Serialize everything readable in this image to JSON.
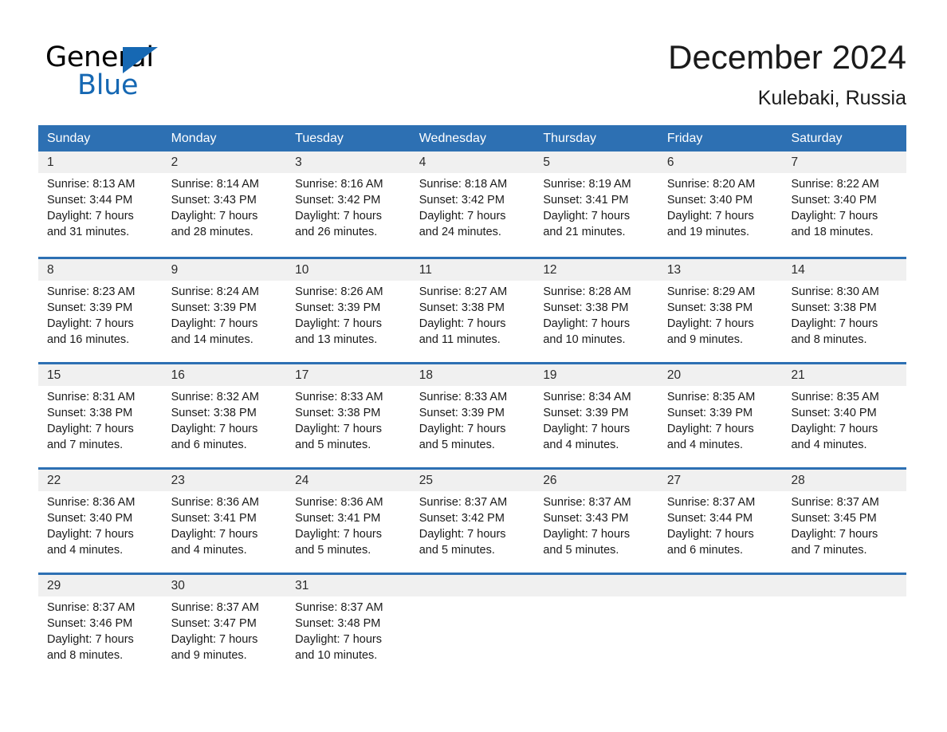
{
  "brand": {
    "name_top": "General",
    "name_bottom": "Blue",
    "color_blue": "#1668b3"
  },
  "header": {
    "month_title": "December 2024",
    "location": "Kulebaki, Russia"
  },
  "theme": {
    "header_blue": "#2d70b3",
    "band_gray": "#f0f0f0",
    "text": "#1a1a1a"
  },
  "calendar": {
    "weekday_headers": [
      "Sunday",
      "Monday",
      "Tuesday",
      "Wednesday",
      "Thursday",
      "Friday",
      "Saturday"
    ],
    "weeks": [
      [
        {
          "day": "1",
          "sunrise": "Sunrise: 8:13 AM",
          "sunset": "Sunset: 3:44 PM",
          "daylight_line1": "Daylight: 7 hours",
          "daylight_line2": "and 31 minutes."
        },
        {
          "day": "2",
          "sunrise": "Sunrise: 8:14 AM",
          "sunset": "Sunset: 3:43 PM",
          "daylight_line1": "Daylight: 7 hours",
          "daylight_line2": "and 28 minutes."
        },
        {
          "day": "3",
          "sunrise": "Sunrise: 8:16 AM",
          "sunset": "Sunset: 3:42 PM",
          "daylight_line1": "Daylight: 7 hours",
          "daylight_line2": "and 26 minutes."
        },
        {
          "day": "4",
          "sunrise": "Sunrise: 8:18 AM",
          "sunset": "Sunset: 3:42 PM",
          "daylight_line1": "Daylight: 7 hours",
          "daylight_line2": "and 24 minutes."
        },
        {
          "day": "5",
          "sunrise": "Sunrise: 8:19 AM",
          "sunset": "Sunset: 3:41 PM",
          "daylight_line1": "Daylight: 7 hours",
          "daylight_line2": "and 21 minutes."
        },
        {
          "day": "6",
          "sunrise": "Sunrise: 8:20 AM",
          "sunset": "Sunset: 3:40 PM",
          "daylight_line1": "Daylight: 7 hours",
          "daylight_line2": "and 19 minutes."
        },
        {
          "day": "7",
          "sunrise": "Sunrise: 8:22 AM",
          "sunset": "Sunset: 3:40 PM",
          "daylight_line1": "Daylight: 7 hours",
          "daylight_line2": "and 18 minutes."
        }
      ],
      [
        {
          "day": "8",
          "sunrise": "Sunrise: 8:23 AM",
          "sunset": "Sunset: 3:39 PM",
          "daylight_line1": "Daylight: 7 hours",
          "daylight_line2": "and 16 minutes."
        },
        {
          "day": "9",
          "sunrise": "Sunrise: 8:24 AM",
          "sunset": "Sunset: 3:39 PM",
          "daylight_line1": "Daylight: 7 hours",
          "daylight_line2": "and 14 minutes."
        },
        {
          "day": "10",
          "sunrise": "Sunrise: 8:26 AM",
          "sunset": "Sunset: 3:39 PM",
          "daylight_line1": "Daylight: 7 hours",
          "daylight_line2": "and 13 minutes."
        },
        {
          "day": "11",
          "sunrise": "Sunrise: 8:27 AM",
          "sunset": "Sunset: 3:38 PM",
          "daylight_line1": "Daylight: 7 hours",
          "daylight_line2": "and 11 minutes."
        },
        {
          "day": "12",
          "sunrise": "Sunrise: 8:28 AM",
          "sunset": "Sunset: 3:38 PM",
          "daylight_line1": "Daylight: 7 hours",
          "daylight_line2": "and 10 minutes."
        },
        {
          "day": "13",
          "sunrise": "Sunrise: 8:29 AM",
          "sunset": "Sunset: 3:38 PM",
          "daylight_line1": "Daylight: 7 hours",
          "daylight_line2": "and 9 minutes."
        },
        {
          "day": "14",
          "sunrise": "Sunrise: 8:30 AM",
          "sunset": "Sunset: 3:38 PM",
          "daylight_line1": "Daylight: 7 hours",
          "daylight_line2": "and 8 minutes."
        }
      ],
      [
        {
          "day": "15",
          "sunrise": "Sunrise: 8:31 AM",
          "sunset": "Sunset: 3:38 PM",
          "daylight_line1": "Daylight: 7 hours",
          "daylight_line2": "and 7 minutes."
        },
        {
          "day": "16",
          "sunrise": "Sunrise: 8:32 AM",
          "sunset": "Sunset: 3:38 PM",
          "daylight_line1": "Daylight: 7 hours",
          "daylight_line2": "and 6 minutes."
        },
        {
          "day": "17",
          "sunrise": "Sunrise: 8:33 AM",
          "sunset": "Sunset: 3:38 PM",
          "daylight_line1": "Daylight: 7 hours",
          "daylight_line2": "and 5 minutes."
        },
        {
          "day": "18",
          "sunrise": "Sunrise: 8:33 AM",
          "sunset": "Sunset: 3:39 PM",
          "daylight_line1": "Daylight: 7 hours",
          "daylight_line2": "and 5 minutes."
        },
        {
          "day": "19",
          "sunrise": "Sunrise: 8:34 AM",
          "sunset": "Sunset: 3:39 PM",
          "daylight_line1": "Daylight: 7 hours",
          "daylight_line2": "and 4 minutes."
        },
        {
          "day": "20",
          "sunrise": "Sunrise: 8:35 AM",
          "sunset": "Sunset: 3:39 PM",
          "daylight_line1": "Daylight: 7 hours",
          "daylight_line2": "and 4 minutes."
        },
        {
          "day": "21",
          "sunrise": "Sunrise: 8:35 AM",
          "sunset": "Sunset: 3:40 PM",
          "daylight_line1": "Daylight: 7 hours",
          "daylight_line2": "and 4 minutes."
        }
      ],
      [
        {
          "day": "22",
          "sunrise": "Sunrise: 8:36 AM",
          "sunset": "Sunset: 3:40 PM",
          "daylight_line1": "Daylight: 7 hours",
          "daylight_line2": "and 4 minutes."
        },
        {
          "day": "23",
          "sunrise": "Sunrise: 8:36 AM",
          "sunset": "Sunset: 3:41 PM",
          "daylight_line1": "Daylight: 7 hours",
          "daylight_line2": "and 4 minutes."
        },
        {
          "day": "24",
          "sunrise": "Sunrise: 8:36 AM",
          "sunset": "Sunset: 3:41 PM",
          "daylight_line1": "Daylight: 7 hours",
          "daylight_line2": "and 5 minutes."
        },
        {
          "day": "25",
          "sunrise": "Sunrise: 8:37 AM",
          "sunset": "Sunset: 3:42 PM",
          "daylight_line1": "Daylight: 7 hours",
          "daylight_line2": "and 5 minutes."
        },
        {
          "day": "26",
          "sunrise": "Sunrise: 8:37 AM",
          "sunset": "Sunset: 3:43 PM",
          "daylight_line1": "Daylight: 7 hours",
          "daylight_line2": "and 5 minutes."
        },
        {
          "day": "27",
          "sunrise": "Sunrise: 8:37 AM",
          "sunset": "Sunset: 3:44 PM",
          "daylight_line1": "Daylight: 7 hours",
          "daylight_line2": "and 6 minutes."
        },
        {
          "day": "28",
          "sunrise": "Sunrise: 8:37 AM",
          "sunset": "Sunset: 3:45 PM",
          "daylight_line1": "Daylight: 7 hours",
          "daylight_line2": "and 7 minutes."
        }
      ],
      [
        {
          "day": "29",
          "sunrise": "Sunrise: 8:37 AM",
          "sunset": "Sunset: 3:46 PM",
          "daylight_line1": "Daylight: 7 hours",
          "daylight_line2": "and 8 minutes."
        },
        {
          "day": "30",
          "sunrise": "Sunrise: 8:37 AM",
          "sunset": "Sunset: 3:47 PM",
          "daylight_line1": "Daylight: 7 hours",
          "daylight_line2": "and 9 minutes."
        },
        {
          "day": "31",
          "sunrise": "Sunrise: 8:37 AM",
          "sunset": "Sunset: 3:48 PM",
          "daylight_line1": "Daylight: 7 hours",
          "daylight_line2": "and 10 minutes."
        },
        {
          "day": "",
          "sunrise": "",
          "sunset": "",
          "daylight_line1": "",
          "daylight_line2": ""
        },
        {
          "day": "",
          "sunrise": "",
          "sunset": "",
          "daylight_line1": "",
          "daylight_line2": ""
        },
        {
          "day": "",
          "sunrise": "",
          "sunset": "",
          "daylight_line1": "",
          "daylight_line2": ""
        },
        {
          "day": "",
          "sunrise": "",
          "sunset": "",
          "daylight_line1": "",
          "daylight_line2": ""
        }
      ]
    ]
  }
}
